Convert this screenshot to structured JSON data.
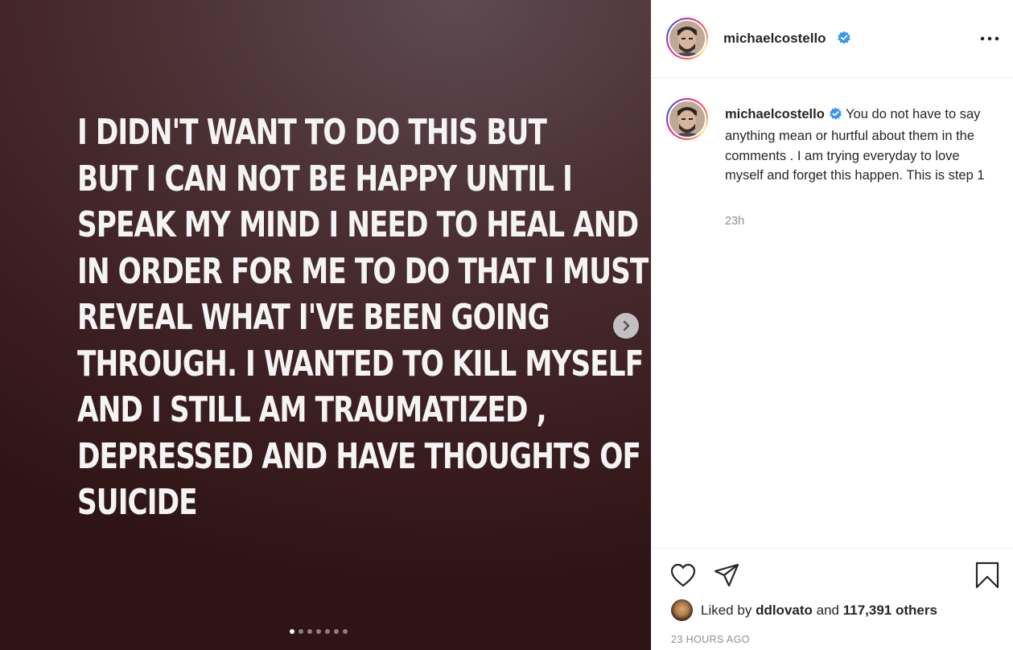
{
  "media": {
    "lines": [
      "I DIDN'T WANT TO DO THIS BUT",
      "BUT I CAN NOT BE HAPPY UNTIL I",
      "SPEAK MY MIND I NEED TO HEAL AND",
      "IN ORDER FOR ME TO DO THAT I MUST",
      "REVEAL WHAT I'VE BEEN GOING",
      "THROUGH. I WANTED TO KILL MYSELF",
      "AND I STILL AM TRAUMATIZED ,",
      "DEPRESSED AND HAVE THOUGHTS OF",
      "SUICIDE"
    ],
    "carousel": {
      "total_slides": 7,
      "active_index": 0
    },
    "next_icon": "chevron-right-icon"
  },
  "header": {
    "username": "michaelcostello",
    "verified_icon": "verified-badge-icon",
    "more_icon": "more-options-icon"
  },
  "caption": {
    "username": "michaelcostello",
    "text": "You do not have to say anything mean or hurtful about them in the comments . I am trying everyday to love myself and forget this happen. This is step 1",
    "time": "23h"
  },
  "actions": {
    "like_icon": "heart-icon",
    "share_icon": "paper-plane-icon",
    "save_icon": "bookmark-icon"
  },
  "likes": {
    "prefix": "Liked by",
    "liker": "ddlovato",
    "conj": "and",
    "count": "117,391 others"
  },
  "post_date": "23 HOURS AGO",
  "colors": {
    "verified": "#3897f0",
    "muted": "#8e8e8e",
    "text": "#262626",
    "border": "#efefef"
  }
}
